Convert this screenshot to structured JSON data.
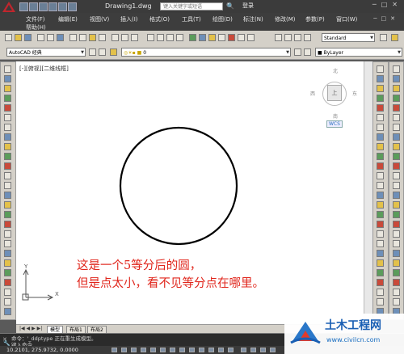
{
  "titlebar": {
    "title": "Drawing1.dwg",
    "search_placeholder": "键入关键字或短语",
    "login": "登录"
  },
  "menubar": {
    "items": [
      "文件(F)",
      "编辑(E)",
      "视图(V)",
      "插入(I)",
      "格式(O)",
      "工具(T)",
      "绘图(D)",
      "标注(N)",
      "修改(M)",
      "参数(P)",
      "窗口(W)",
      "帮助(H)"
    ]
  },
  "toolbar": {
    "text_style": "Standard",
    "workspace": "AutoCAD 经典",
    "layer": "0",
    "color": "ByLayer"
  },
  "viewport": {
    "label": "[-][俯视][二维线框]"
  },
  "viewcube": {
    "north": "北",
    "south": "南",
    "east": "东",
    "west": "西",
    "top_face": "上",
    "wcs": "WCS"
  },
  "annotation": {
    "line1": "这是一个5等分后的圆，",
    "line2": "但是点太小，看不见等分点在哪里。",
    "color": "#e0251b"
  },
  "ucs": {
    "y": "Y",
    "x": "X"
  },
  "tabs": [
    "模型",
    "布局1",
    "布局2"
  ],
  "command": {
    "history": "命令：'_ddptype 正在重生成模型。",
    "prompt": "键入命令"
  },
  "status": {
    "coordinates": "10.2101, 275.9732, 0.0000"
  },
  "watermark": {
    "title": "土木工程网",
    "url": "www.civilcn.com"
  }
}
